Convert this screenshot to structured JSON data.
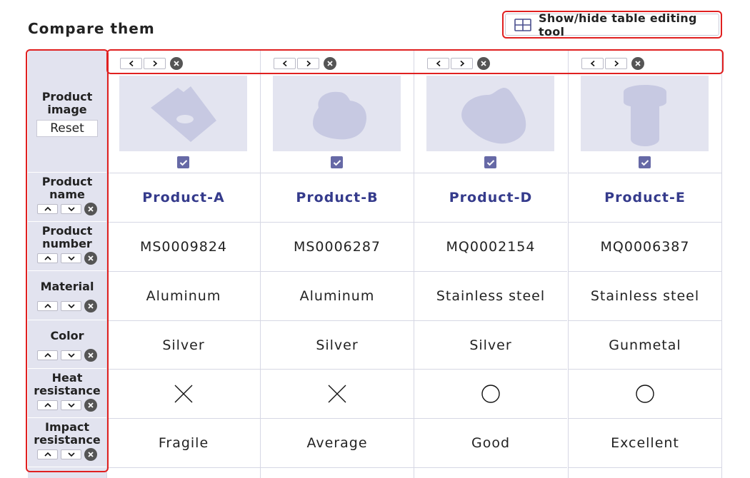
{
  "page": {
    "title": "Compare them"
  },
  "toolbar": {
    "toggle_label": "Show/hide table editing tool",
    "toggle_icon": "table-icon"
  },
  "row_headers": [
    {
      "label": "Product image",
      "reset_label": "Reset"
    },
    {
      "label": "Product name"
    },
    {
      "label": "Product number"
    },
    {
      "label": "Material"
    },
    {
      "label": "Color"
    },
    {
      "label": "Heat resistance"
    },
    {
      "label": "Impact resistance"
    }
  ],
  "products": [
    {
      "name": "Product-A",
      "number": "MS0009824",
      "material": "Aluminum",
      "color": "Silver",
      "heat_resistance": "cross",
      "impact_resistance": "Fragile",
      "image_icon": "square-plate-icon",
      "checked": true
    },
    {
      "name": "Product-B",
      "number": "MS0006287",
      "material": "Aluminum",
      "color": "Silver",
      "heat_resistance": "cross",
      "impact_resistance": "Average",
      "image_icon": "round-block-icon",
      "checked": true
    },
    {
      "name": "Product-D",
      "number": "MQ0002154",
      "material": "Stainless steel",
      "color": "Silver",
      "heat_resistance": "circle",
      "impact_resistance": "Good",
      "image_icon": "curved-plate-icon",
      "checked": true
    },
    {
      "name": "Product-E",
      "number": "MQ0006387",
      "material": "Stainless steel",
      "color": "Gunmetal",
      "heat_resistance": "circle",
      "impact_resistance": "Excellent",
      "image_icon": "t-shaped-pin-icon",
      "checked": true
    }
  ],
  "colors": {
    "accent": "#353b8c",
    "highlight": "#e02020",
    "header_bg": "#e2e3ef",
    "image_bg": "#e3e4f0",
    "shape": "#c7c9e2",
    "checkbox": "#6669a6"
  }
}
